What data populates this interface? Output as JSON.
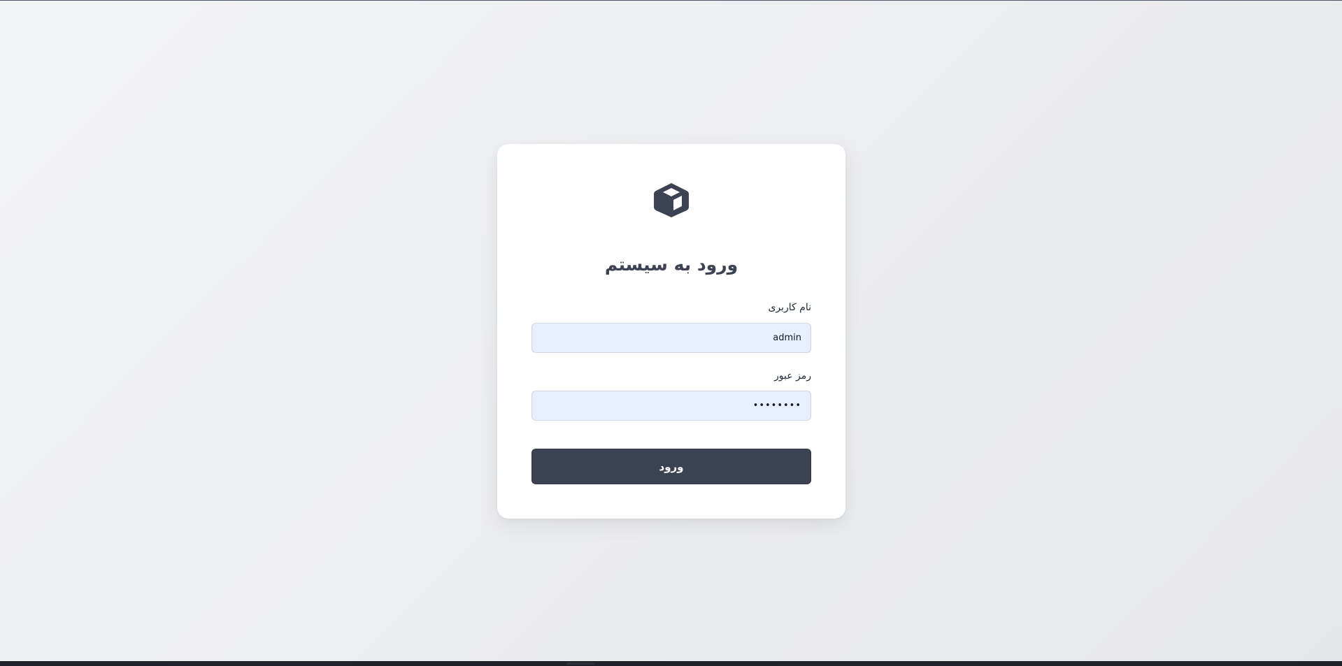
{
  "login": {
    "title": "ورود به سیستم",
    "logo_icon": "cube-icon",
    "username": {
      "label": "نام کاربری",
      "value": "admin"
    },
    "password": {
      "label": "رمز عبور",
      "value": "password"
    },
    "submit_label": "ورود"
  },
  "colors": {
    "accent": "#3b4252",
    "input_bg": "#e8f0fe",
    "card_bg": "#ffffff"
  }
}
